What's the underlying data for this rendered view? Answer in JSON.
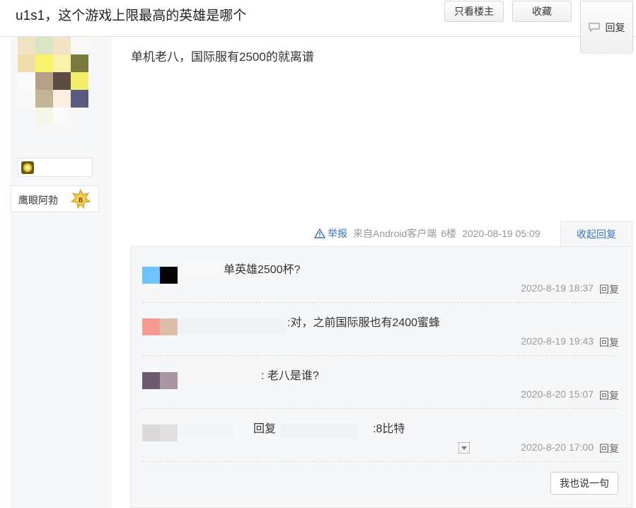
{
  "header": {
    "title": "u1s1，这个游戏上限最高的英雄是哪个",
    "buttons": {
      "louzhu": "只看楼主",
      "shoucang": "收藏",
      "reply": "回复"
    }
  },
  "user": {
    "title_name": "鹰眼阿勃",
    "level": "8"
  },
  "post": {
    "content": "单机老八，国际服有2500的就离谱",
    "meta": {
      "report": "举报",
      "from": "来自Android客户端",
      "floor": "6楼",
      "time": "2020-08-19 05:09"
    },
    "collapse_label": "收起回复"
  },
  "replies": [
    {
      "text": "单英雄2500杯?",
      "time": "2020-8-19 18:37",
      "reply_label": "回复"
    },
    {
      "text": ":对，之前国际服也有2400蜜蜂",
      "time": "2020-8-19 19:43",
      "reply_label": "回复"
    },
    {
      "text": ": 老八是谁?",
      "time": "2020-8-20 15:07",
      "reply_label": "回复"
    },
    {
      "prefix": "回复",
      "text": ":8比特",
      "time": "2020-8-20 17:00",
      "reply_label": "回复"
    }
  ],
  "say_button": "我也说一句",
  "colors": {
    "link_blue": "#3b74c3",
    "meta_gray": "#999999",
    "panel_bg": "#f6f7f9"
  }
}
